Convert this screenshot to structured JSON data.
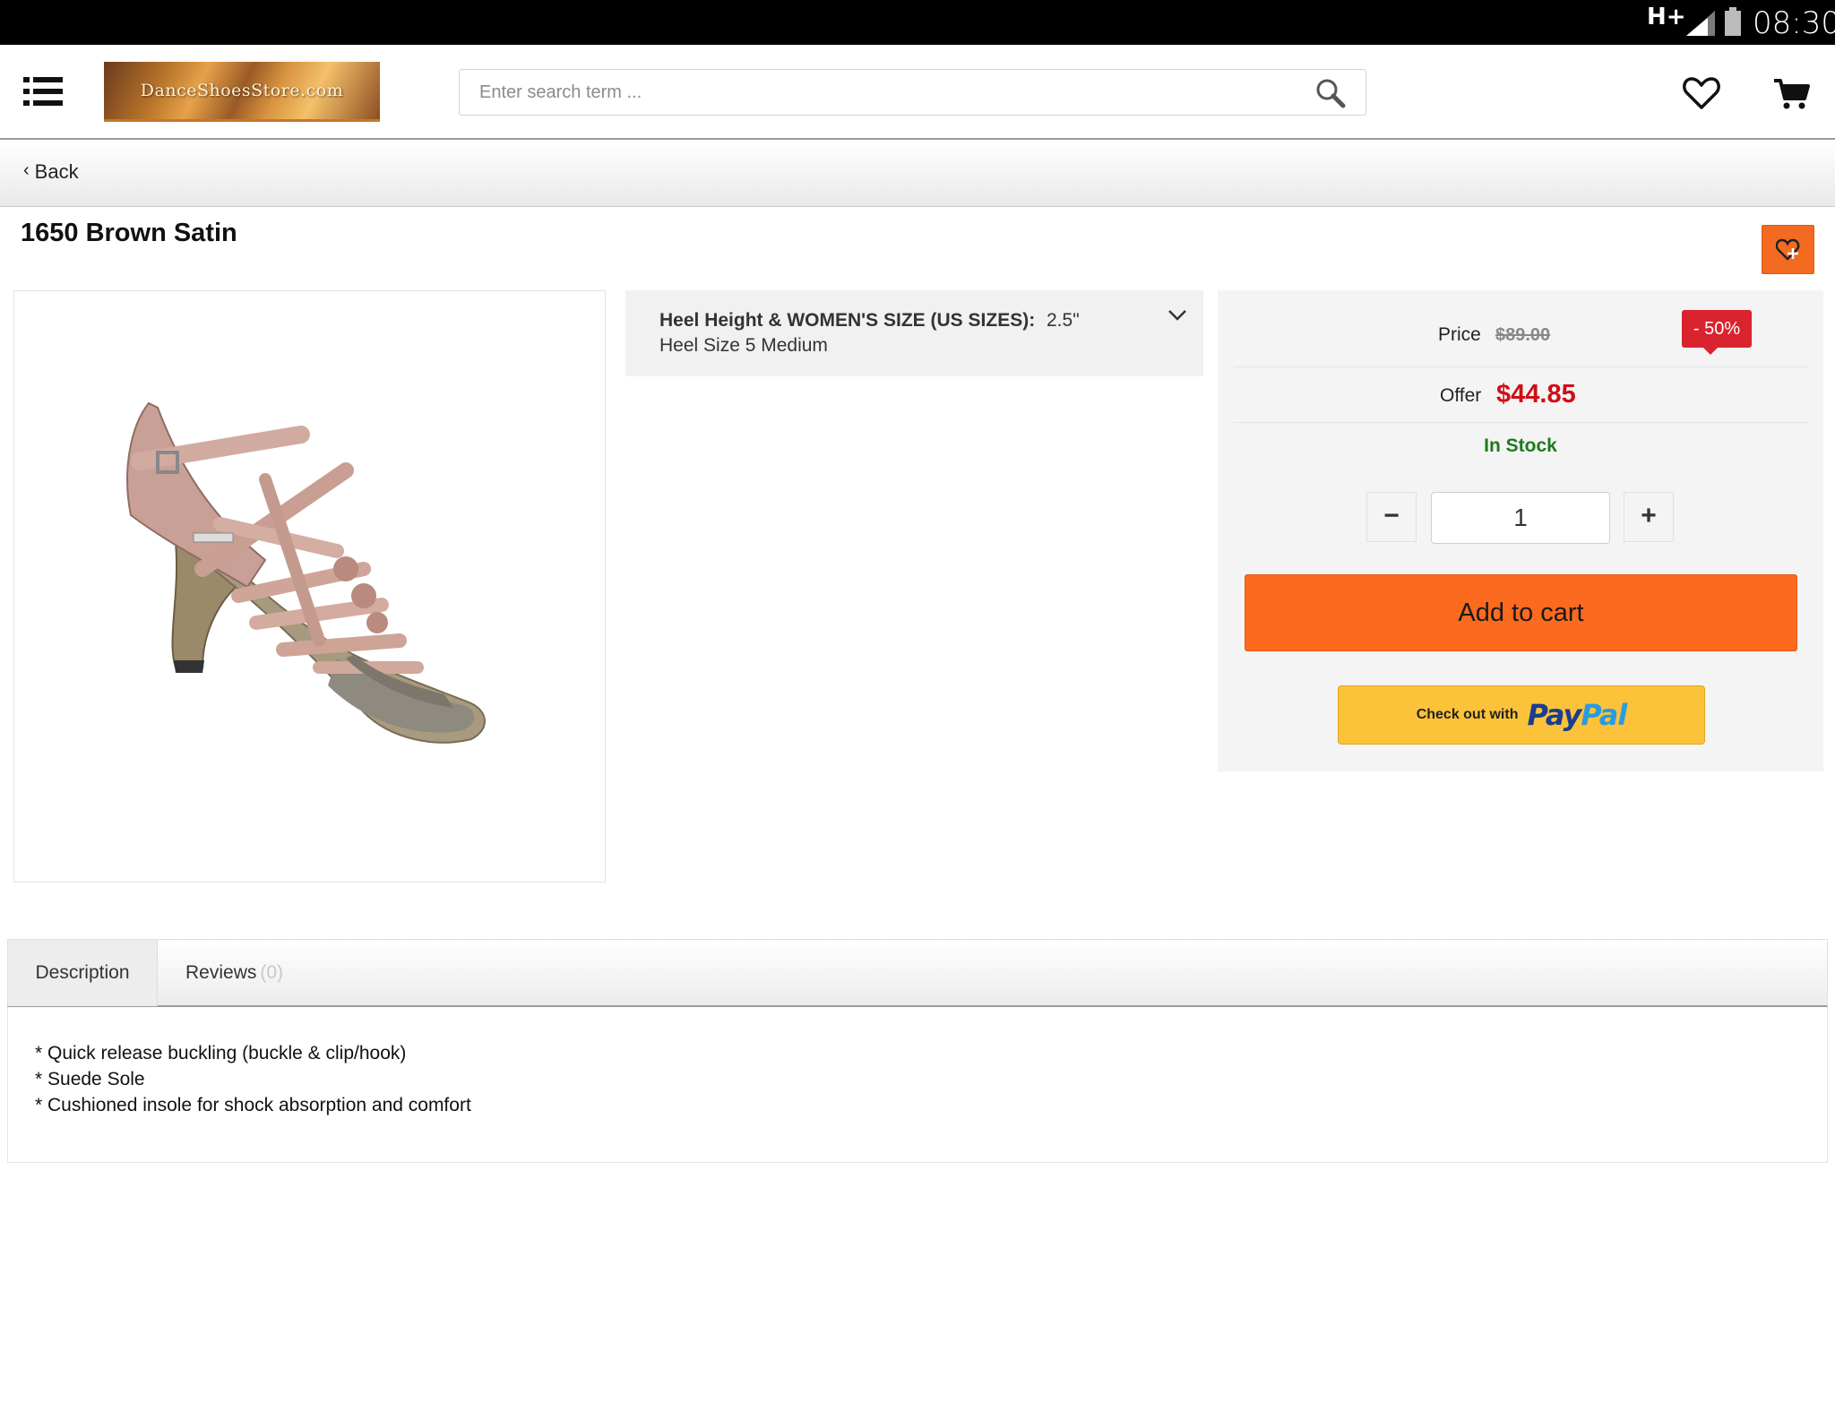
{
  "status_bar": {
    "network": "H+",
    "time": "08:30"
  },
  "header": {
    "logo_text": "DanceShoesStore.com",
    "search_placeholder": "Enter search term ...",
    "icons": [
      "menu-icon",
      "search-icon",
      "heart-icon",
      "cart-icon"
    ]
  },
  "nav": {
    "back_label": "Back"
  },
  "product": {
    "title": "1650 Brown Satin",
    "option_label": "Heel Height & WOMEN'S SIZE (US SIZES):",
    "option_value": "2.5\"",
    "option_value_2": "Heel Size 5 Medium"
  },
  "pricing": {
    "price_label": "Price",
    "old_price": "$89.00",
    "discount": "- 50%",
    "offer_label": "Offer",
    "offer_price": "$44.85",
    "stock_status": "In Stock",
    "quantity": "1",
    "minus_label": "−",
    "plus_label": "+",
    "add_to_cart_label": "Add to cart",
    "paypal_prefix": "Check out with",
    "paypal_pay": "Pay",
    "paypal_pal": "Pal"
  },
  "tabs": {
    "description_label": "Description",
    "reviews_label": "Reviews",
    "reviews_count": "(0)"
  },
  "description": {
    "lines": [
      "* Quick release buckling (buckle & clip/hook)",
      "* Suede Sole",
      "* Cushioned insole for shock absorption and comfort"
    ]
  },
  "colors": {
    "accent_orange": "#fb6a1f",
    "offer_red": "#d10d16",
    "discount_red": "#d9232e",
    "stock_green": "#1d7a1d",
    "paypal_yellow": "#fcc33a"
  }
}
